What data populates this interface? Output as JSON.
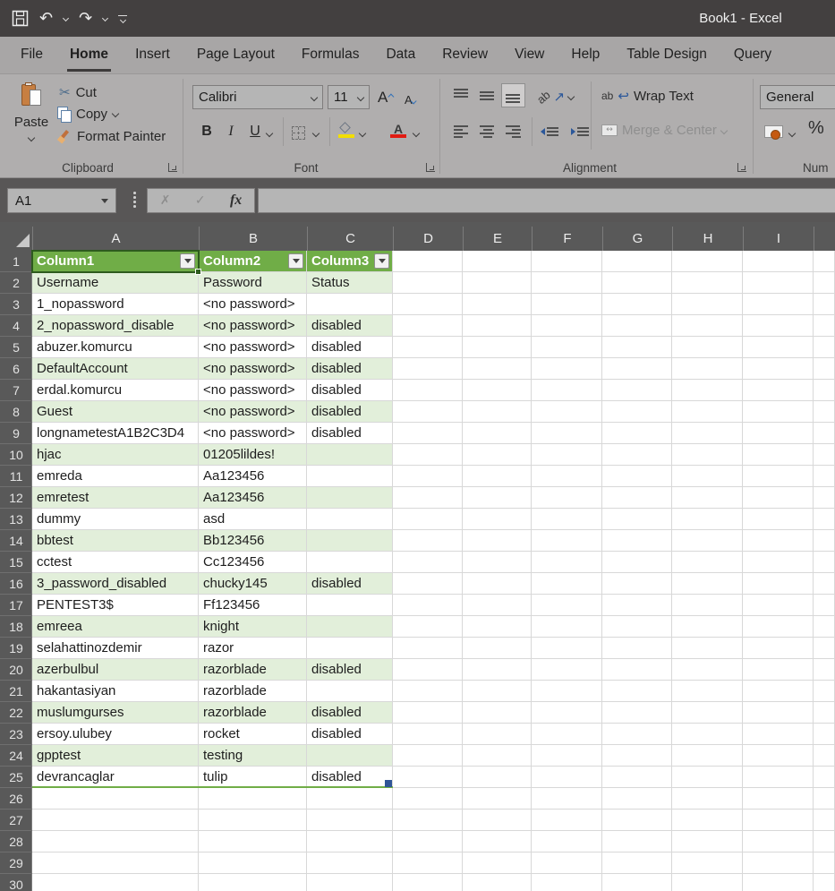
{
  "window": {
    "title": "Book1 - Excel"
  },
  "icons": {
    "qat": [
      "save-icon",
      "undo-icon",
      "redo-icon",
      "customize-qat-icon"
    ],
    "undo_glyph": "↶",
    "redo_glyph": "↷",
    "scissors_glyph": "✂",
    "wrap_arrow_glyph": "↩",
    "orient_arrow_glyph": "↗",
    "merge_arrows_glyph": "↔"
  },
  "menu_tabs": [
    {
      "label": "File",
      "active": false
    },
    {
      "label": "Home",
      "active": true
    },
    {
      "label": "Insert",
      "active": false
    },
    {
      "label": "Page Layout",
      "active": false
    },
    {
      "label": "Formulas",
      "active": false
    },
    {
      "label": "Data",
      "active": false
    },
    {
      "label": "Review",
      "active": false
    },
    {
      "label": "View",
      "active": false
    },
    {
      "label": "Help",
      "active": false
    },
    {
      "label": "Table Design",
      "active": false
    },
    {
      "label": "Query",
      "active": false
    }
  ],
  "ribbon": {
    "clipboard": {
      "group_label": "Clipboard",
      "paste_label": "Paste",
      "cut_label": "Cut",
      "copy_label": "Copy",
      "format_painter_label": "Format Painter"
    },
    "font": {
      "group_label": "Font",
      "font_name": "Calibri",
      "font_size": "11",
      "bold": "B",
      "italic": "I",
      "underline": "U",
      "grow_letter": "A",
      "shrink_letter": "A",
      "font_color_letter": "A"
    },
    "alignment": {
      "group_label": "Alignment",
      "orientation_letters": "ab",
      "wrap_icon_letters": "ab",
      "wrap_text_label": "Wrap Text",
      "merge_center_label": "Merge & Center"
    },
    "number": {
      "group_label": "Num",
      "format_value": "General",
      "percent_label": "%"
    }
  },
  "formula_bar": {
    "name_box_value": "A1",
    "cancel_glyph": "✗",
    "enter_glyph": "✓",
    "fx_label": "fx",
    "formula_value": ""
  },
  "sheet": {
    "column_letters": [
      "A",
      "B",
      "C",
      "D",
      "E",
      "F",
      "G",
      "H",
      "I"
    ],
    "first_row_number": 1,
    "last_row_number": 30,
    "selected_cell": "A1",
    "table_headers": [
      "Column1",
      "Column2",
      "Column3"
    ],
    "table_rows": [
      [
        "Username",
        "Password",
        "Status"
      ],
      [
        "1_nopassword",
        "<no password>",
        ""
      ],
      [
        "2_nopassword_disable",
        "<no password>",
        "disabled"
      ],
      [
        "abuzer.komurcu",
        "<no password>",
        "disabled"
      ],
      [
        "DefaultAccount",
        "<no password>",
        "disabled"
      ],
      [
        "erdal.komurcu",
        "<no password>",
        "disabled"
      ],
      [
        "Guest",
        "<no password>",
        "disabled"
      ],
      [
        "longnametestA1B2C3D4",
        "<no password>",
        "disabled"
      ],
      [
        "hjac",
        "01205lildes!",
        ""
      ],
      [
        "emreda",
        "Aa123456",
        ""
      ],
      [
        "emretest",
        "Aa123456",
        ""
      ],
      [
        "dummy",
        "asd",
        ""
      ],
      [
        "bbtest",
        "Bb123456",
        ""
      ],
      [
        "cctest",
        "Cc123456",
        ""
      ],
      [
        "3_password_disabled",
        "chucky145",
        "disabled"
      ],
      [
        "PENTEST3$",
        "Ff123456",
        ""
      ],
      [
        "emreea",
        "knight",
        ""
      ],
      [
        "selahattinozdemir",
        "razor",
        ""
      ],
      [
        "azerbulbul",
        "razorblade",
        "disabled"
      ],
      [
        "hakantasiyan",
        "razorblade",
        ""
      ],
      [
        "muslumgurses",
        "razorblade",
        "disabled"
      ],
      [
        "ersoy.ulubey",
        "rocket",
        "disabled"
      ],
      [
        "gpptest",
        "testing",
        ""
      ],
      [
        "devrancaglar",
        "tulip",
        "disabled"
      ]
    ]
  },
  "colors": {
    "table_header_green": "#70AD47",
    "band_green": "#E2EFDA",
    "selection_green": "#2E5B1E",
    "table_handle_blue": "#2F5597",
    "fill_yellow": "#F2DE00",
    "font_color_red": "#E11B12",
    "titlebar_gray": "#434040",
    "ribbon_gray": "#B0AEAE",
    "header_gray": "#595959"
  }
}
